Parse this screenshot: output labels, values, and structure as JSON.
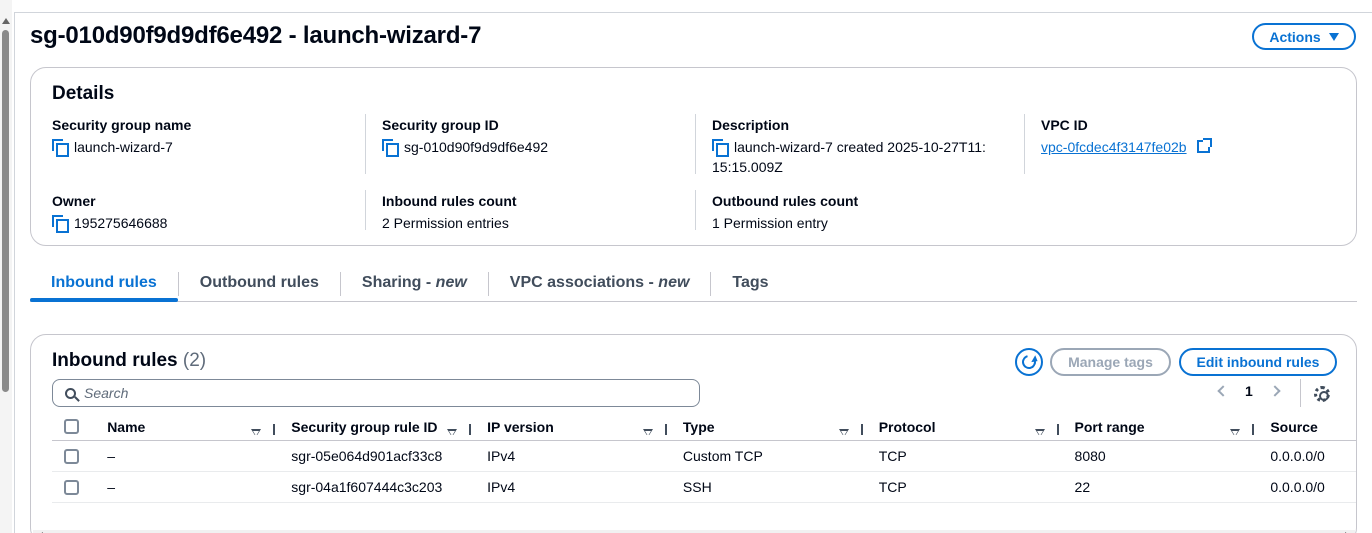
{
  "page": {
    "title": "sg-010d90f9d9df6e492 - launch-wizard-7",
    "actions_label": "Actions"
  },
  "details": {
    "title": "Details",
    "fields": [
      {
        "label": "Security group name",
        "value": "launch-wizard-7",
        "icon": "copy-icon"
      },
      {
        "label": "Security group ID",
        "value": "sg-010d90f9d9df6e492",
        "icon": "copy-icon"
      },
      {
        "label": "Description",
        "value": "launch-wizard-7 created 2025-10-27T11:",
        "value2": "15:15.009Z",
        "icon": "copy-icon"
      },
      {
        "label": "VPC ID",
        "value": "vpc-0fcdec4f3147fe02b",
        "icon": "external-link-icon"
      },
      {
        "label": "Owner",
        "value": "195275646688",
        "icon": "copy-icon"
      },
      {
        "label": "Inbound rules count",
        "value": "2 Permission entries"
      },
      {
        "label": "Outbound rules count",
        "value": "1 Permission entry"
      }
    ]
  },
  "tabs": [
    {
      "label": "Inbound rules",
      "suffix": ""
    },
    {
      "label": "Outbound rules",
      "suffix": ""
    },
    {
      "label": "Sharing - ",
      "suffix": "new"
    },
    {
      "label": "VPC associations - ",
      "suffix": "new"
    },
    {
      "label": "Tags",
      "suffix": ""
    }
  ],
  "inbound": {
    "title": "Inbound rules",
    "count": "(2)",
    "manage_tags_label": "Manage tags",
    "edit_label": "Edit inbound rules",
    "search_placeholder": "Search",
    "page_number": "1",
    "columns": [
      "Name",
      "Security group rule ID",
      "IP version",
      "Type",
      "Protocol",
      "Port range",
      "Source"
    ],
    "rows": [
      [
        "–",
        "sgr-05e064d901acf33c8",
        "IPv4",
        "Custom TCP",
        "TCP",
        "8080",
        "0.0.0.0/0"
      ],
      [
        "–",
        "sgr-04a1f607444c3c203",
        "IPv4",
        "SSH",
        "TCP",
        "22",
        "0.0.0.0/0"
      ]
    ]
  },
  "colors": {
    "accent": "#0972d3",
    "disabled": "#9ba7b6",
    "text": "#000716"
  }
}
